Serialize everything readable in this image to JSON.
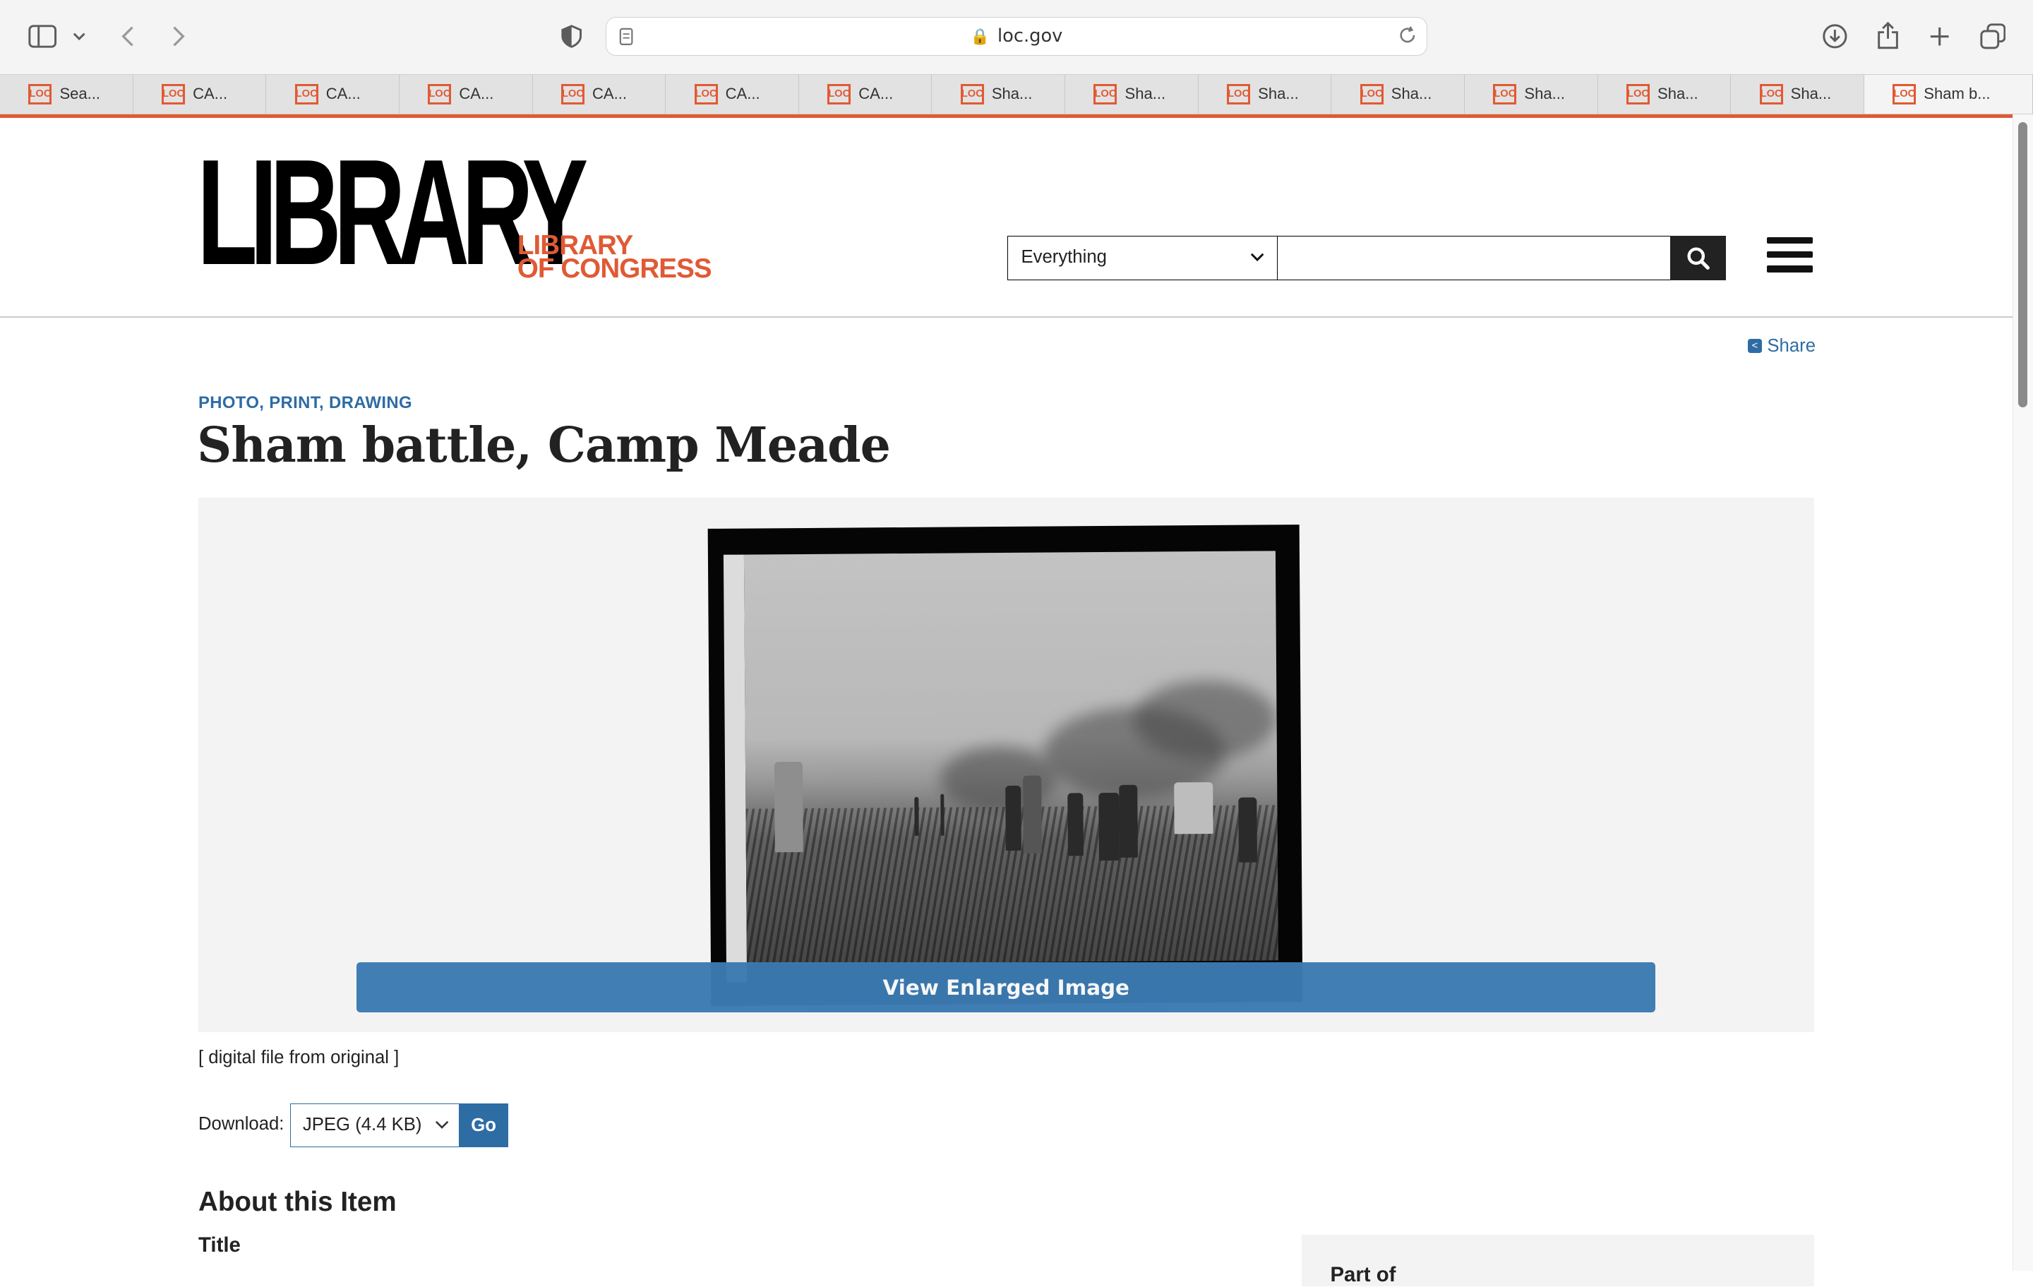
{
  "browser": {
    "address_domain": "loc.gov",
    "tabs": [
      {
        "label": "Sea..."
      },
      {
        "label": "CA..."
      },
      {
        "label": "CA..."
      },
      {
        "label": "CA..."
      },
      {
        "label": "CA..."
      },
      {
        "label": "CA..."
      },
      {
        "label": "CA..."
      },
      {
        "label": "Sha..."
      },
      {
        "label": "Sha..."
      },
      {
        "label": "Sha..."
      },
      {
        "label": "Sha..."
      },
      {
        "label": "Sha..."
      },
      {
        "label": "Sha..."
      },
      {
        "label": "Sha..."
      },
      {
        "label": "Sham b..."
      }
    ],
    "favicon_text": "LOC",
    "active_tab_index": 14
  },
  "header": {
    "logo_word": "LIBRARY",
    "logo_sub_line1": "LIBRARY",
    "logo_sub_line2": "OF CONGRESS",
    "search_scope": "Everything",
    "search_value": ""
  },
  "share_label": "Share",
  "item": {
    "format": "PHOTO, PRINT, DRAWING",
    "title": "Sham battle, Camp Meade",
    "enlarge_label": "View Enlarged Image",
    "caption": "[ digital file from original ]",
    "download_label": "Download:",
    "download_option": "JPEG (4.4 KB)",
    "go_label": "Go"
  },
  "about": {
    "heading": "About this Item",
    "first_field": "Title",
    "sidebar_heading": "Part of"
  },
  "colors": {
    "accent_orange": "#e05a34",
    "link_blue": "#2e6ca4",
    "button_blue": "#3b7ab2"
  }
}
